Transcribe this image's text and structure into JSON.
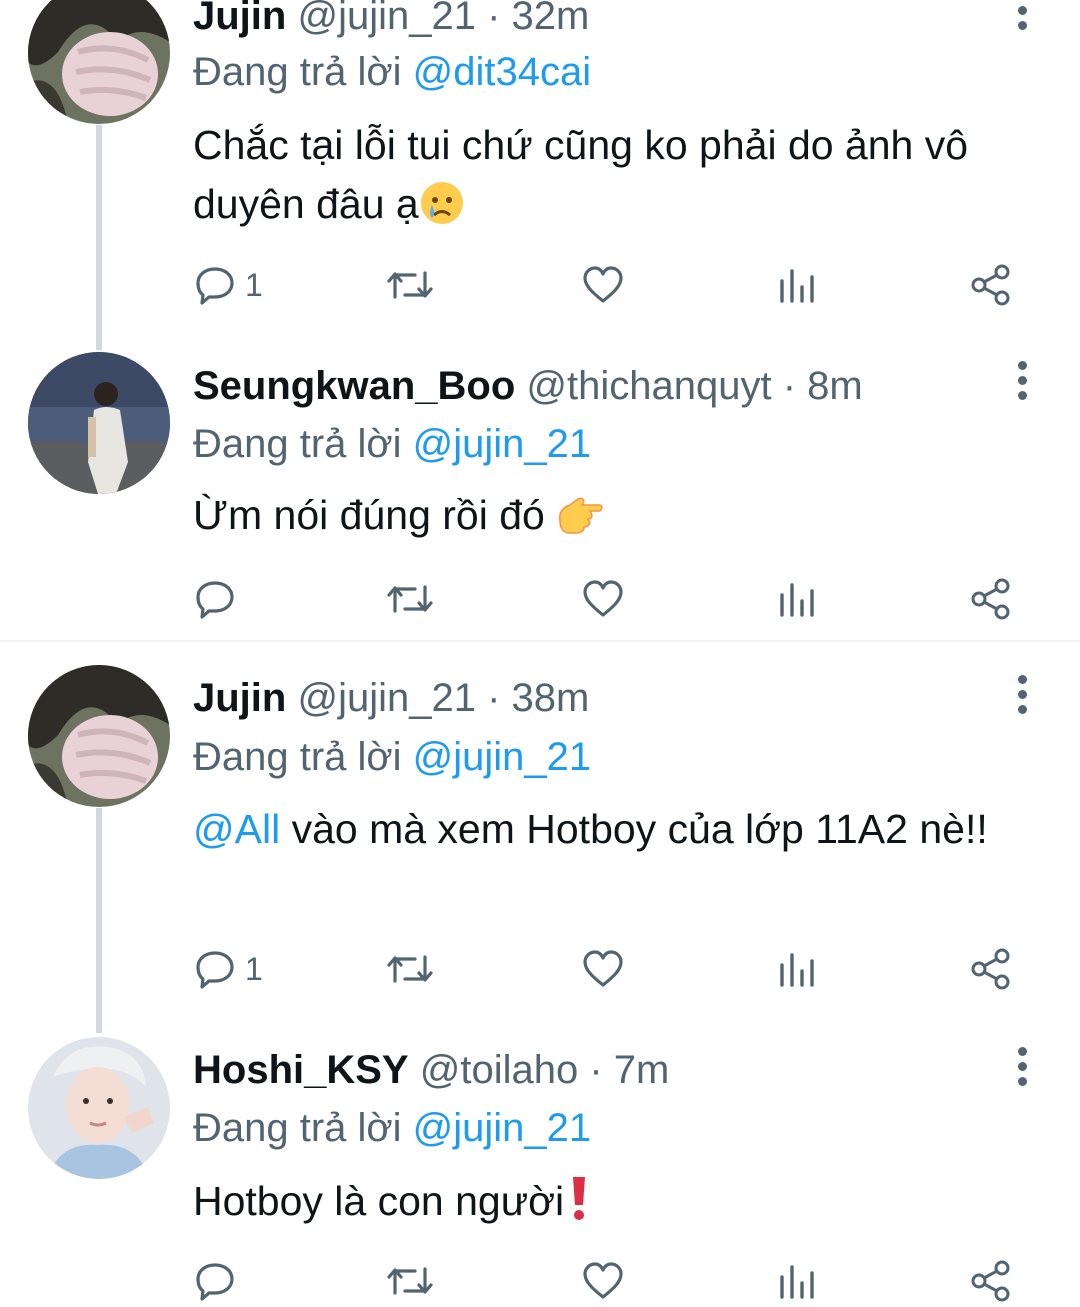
{
  "colors": {
    "accent": "#1d9bf0",
    "secondary_text": "#536471",
    "primary_text": "#0f1419",
    "thread_line": "#cfd9de"
  },
  "tweets": [
    {
      "name": "Jujin",
      "handle": "@jujin_21",
      "dot": "·",
      "time": "32m",
      "reply_prefix": "Đang trả lời",
      "reply_to": "@dit34cai",
      "text": "Chắc tại lỗi tui chứ cũng ko phải do ảnh vô duyên đâu ạ",
      "emoji": "crying-face",
      "reply_count": "1"
    },
    {
      "name": "Seungkwan_Boo",
      "handle": "@thichanquyt",
      "dot": "·",
      "time": "8m",
      "reply_prefix": "Đang trả lời",
      "reply_to": "@jujin_21",
      "text": "Ừm nói đúng rồi đó ",
      "emoji": "pointing-hand",
      "reply_count": ""
    },
    {
      "name": "Jujin",
      "handle": "@jujin_21",
      "dot": "·",
      "time": "38m",
      "reply_prefix": "Đang trả lời",
      "reply_to": "@jujin_21",
      "mention": "@All",
      "text": " vào mà xem Hotboy của lớp 11A2 nè!!",
      "reply_count": "1"
    },
    {
      "name": "Hoshi_KSY",
      "handle": "@toilaho",
      "dot": "·",
      "time": "7m",
      "reply_prefix": "Đang trả lời",
      "reply_to": "@jujin_21",
      "text": "Hotboy là con người",
      "emoji": "red-exclamation",
      "reply_count": ""
    }
  ],
  "action_icons": [
    "reply-icon",
    "retweet-icon",
    "like-icon",
    "views-icon",
    "share-icon"
  ]
}
